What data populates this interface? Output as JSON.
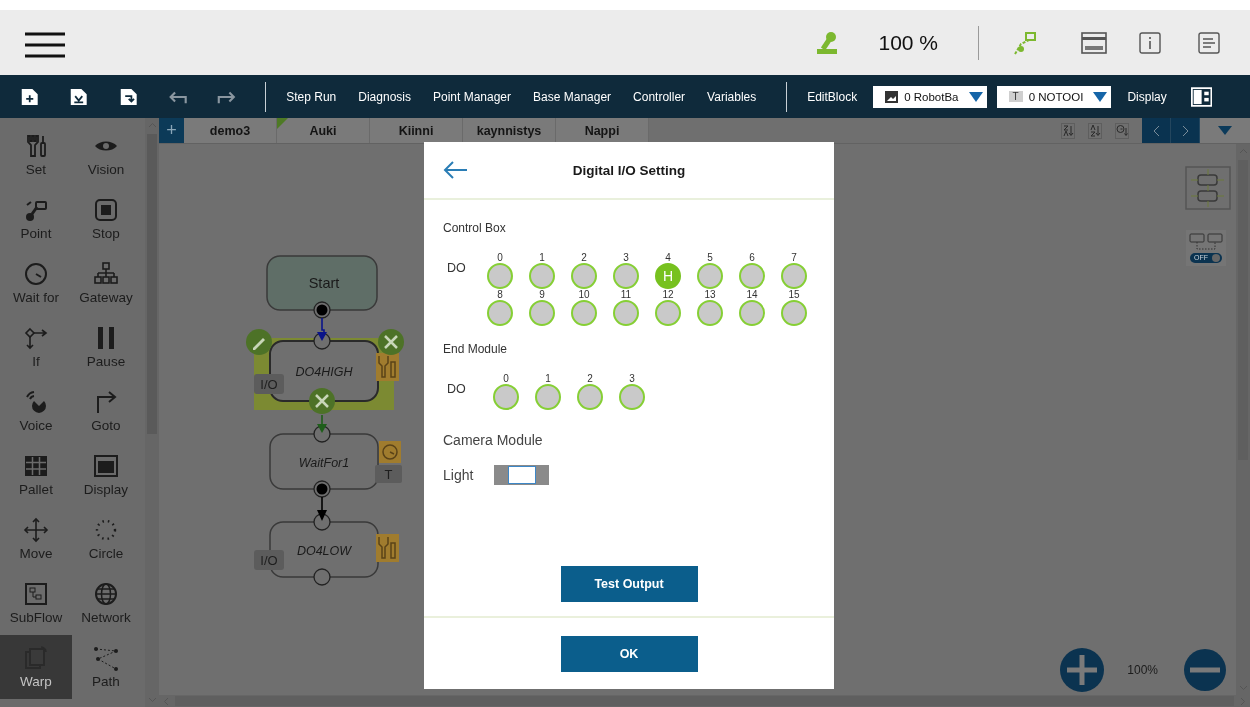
{
  "header": {
    "speed": "100 %"
  },
  "toolbar": {
    "items": [
      "Step Run",
      "Diagnosis",
      "Point Manager",
      "Base Manager",
      "Controller",
      "Variables"
    ],
    "edit_block": "EditBlock",
    "base_dropdown": "0 RobotBa",
    "tool_badge": "T",
    "tool_dropdown": "0 NOTOOI",
    "display": "Display"
  },
  "palette": [
    {
      "label": "Set",
      "selected": false
    },
    {
      "label": "Vision",
      "selected": false
    },
    {
      "label": "Point",
      "selected": false
    },
    {
      "label": "Stop",
      "selected": false
    },
    {
      "label": "Wait for",
      "selected": false
    },
    {
      "label": "Gateway",
      "selected": false
    },
    {
      "label": "If",
      "selected": false
    },
    {
      "label": "Pause",
      "selected": false
    },
    {
      "label": "Voice",
      "selected": false
    },
    {
      "label": "Goto",
      "selected": false
    },
    {
      "label": "Pallet",
      "selected": false
    },
    {
      "label": "Display",
      "selected": false
    },
    {
      "label": "Move",
      "selected": false
    },
    {
      "label": "Circle",
      "selected": false
    },
    {
      "label": "SubFlow",
      "selected": false
    },
    {
      "label": "Network",
      "selected": false
    },
    {
      "label": "Warp",
      "selected": true
    },
    {
      "label": "Path",
      "selected": false
    }
  ],
  "tabs": [
    {
      "label": "demo3",
      "flagged": false
    },
    {
      "label": "Auki",
      "flagged": true
    },
    {
      "label": "Kiinni",
      "flagged": false
    },
    {
      "label": "kaynnistys",
      "flagged": false
    },
    {
      "label": "Nappi",
      "flagged": false
    }
  ],
  "add_tab": "+",
  "flow": {
    "nodes": [
      {
        "kind": "start",
        "label": "Start",
        "selected": false
      },
      {
        "kind": "io",
        "label": "DO4HIGH",
        "tag": "I/O",
        "selected": true
      },
      {
        "kind": "wait",
        "label": "WaitFor1",
        "tag": "T",
        "selected": false
      },
      {
        "kind": "io",
        "label": "DO4LOW",
        "tag": "I/O",
        "selected": false
      }
    ]
  },
  "link_toggle": {
    "label": "OFF",
    "on": false
  },
  "zoom": "100%",
  "dialog": {
    "title": "Digital I/O Setting",
    "sections": [
      {
        "title": "Control Box",
        "row_label": "DO",
        "outputs": [
          {
            "index": "0",
            "on": false
          },
          {
            "index": "1",
            "on": false
          },
          {
            "index": "2",
            "on": false
          },
          {
            "index": "3",
            "on": false
          },
          {
            "index": "4",
            "on": true,
            "value": "H"
          },
          {
            "index": "5",
            "on": false
          },
          {
            "index": "6",
            "on": false
          },
          {
            "index": "7",
            "on": false
          },
          {
            "index": "8",
            "on": false
          },
          {
            "index": "9",
            "on": false
          },
          {
            "index": "10",
            "on": false
          },
          {
            "index": "11",
            "on": false
          },
          {
            "index": "12",
            "on": false
          },
          {
            "index": "13",
            "on": false
          },
          {
            "index": "14",
            "on": false
          },
          {
            "index": "15",
            "on": false
          }
        ]
      },
      {
        "title": "End Module",
        "row_label": "DO",
        "outputs": [
          {
            "index": "0",
            "on": false
          },
          {
            "index": "1",
            "on": false
          },
          {
            "index": "2",
            "on": false
          },
          {
            "index": "3",
            "on": false
          }
        ]
      }
    ],
    "camera": {
      "title": "Camera Module",
      "light_label": "Light",
      "light_on": false
    },
    "test_button": "Test Output",
    "ok_button": "OK"
  }
}
